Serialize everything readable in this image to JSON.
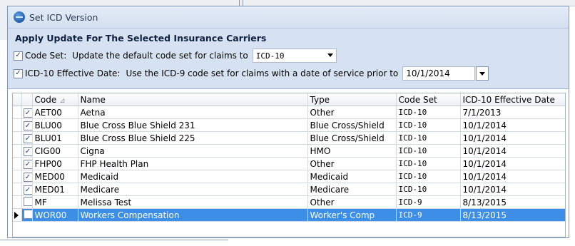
{
  "window": {
    "title": "Set ICD Version"
  },
  "panel": {
    "heading": "Apply Update For The Selected Insurance Carriers",
    "code_set": {
      "checked": true,
      "label": "Code Set:",
      "description": "Update the default code set for claims to",
      "value": "ICD-10"
    },
    "effective_date": {
      "checked": true,
      "label": "ICD-10 Effective Date:",
      "description": "Use the ICD-9 code set for claims with a date of service prior to",
      "value": "10/1/2014"
    }
  },
  "grid": {
    "columns": [
      "Code",
      "Name",
      "Type",
      "Code Set",
      "ICD-10 Effective Date"
    ],
    "rows": [
      {
        "checked": true,
        "code": "AET00",
        "name": "Aetna",
        "type": "Other",
        "code_set": "ICD-10",
        "effective_date": "7/1/2013"
      },
      {
        "checked": true,
        "code": "BLU00",
        "name": "Blue Cross Blue Shield 231",
        "type": "Blue Cross/Shield",
        "code_set": "ICD-10",
        "effective_date": "10/1/2014"
      },
      {
        "checked": true,
        "code": "BLU01",
        "name": "Blue Cross Blue Shield 225",
        "type": "Blue Cross/Shield",
        "code_set": "ICD-10",
        "effective_date": "10/1/2014"
      },
      {
        "checked": true,
        "code": "CIG00",
        "name": "Cigna",
        "type": "HMO",
        "code_set": "ICD-10",
        "effective_date": "10/1/2014"
      },
      {
        "checked": true,
        "code": "FHP00",
        "name": "FHP Health Plan",
        "type": "Other",
        "code_set": "ICD-10",
        "effective_date": "10/1/2014"
      },
      {
        "checked": true,
        "code": "MED00",
        "name": "Medicaid",
        "type": "Medicaid",
        "code_set": "ICD-10",
        "effective_date": "10/1/2014"
      },
      {
        "checked": true,
        "code": "MED01",
        "name": "Medicare",
        "type": "Medicare",
        "code_set": "ICD-10",
        "effective_date": "10/1/2014"
      },
      {
        "checked": false,
        "code": "MF",
        "name": "Melissa Test",
        "type": "Other",
        "code_set": "ICD-9",
        "effective_date": "8/13/2015"
      },
      {
        "checked": false,
        "code": "WOR00",
        "name": "Workers Compensation",
        "type": "Worker's Comp",
        "code_set": "ICD-9",
        "effective_date": "8/13/2015",
        "selected": true
      }
    ]
  }
}
